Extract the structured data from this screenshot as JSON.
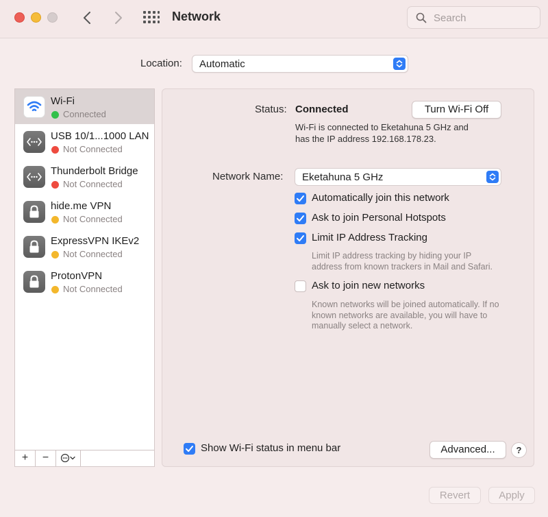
{
  "window": {
    "title": "Network",
    "search_placeholder": "Search"
  },
  "location": {
    "label": "Location:",
    "value": "Automatic"
  },
  "services": [
    {
      "name": "Wi-Fi",
      "status": "Connected",
      "status_color": "#32c04a",
      "icon": "wifi-icon",
      "selected": true
    },
    {
      "name": "USB 10/1...1000 LAN",
      "status": "Not Connected",
      "status_color": "#ee4b3f",
      "icon": "ethernet-icon",
      "selected": false
    },
    {
      "name": "Thunderbolt Bridge",
      "status": "Not Connected",
      "status_color": "#ee4b3f",
      "icon": "ethernet-icon",
      "selected": false
    },
    {
      "name": "hide.me VPN",
      "status": "Not Connected",
      "status_color": "#f3b72c",
      "icon": "lock-icon",
      "selected": false
    },
    {
      "name": "ExpressVPN IKEv2",
      "status": "Not Connected",
      "status_color": "#f3b72c",
      "icon": "lock-icon",
      "selected": false
    },
    {
      "name": "ProtonVPN",
      "status": "Not Connected",
      "status_color": "#f3b72c",
      "icon": "lock-icon",
      "selected": false
    }
  ],
  "sidebar_toolbar": {
    "add": "+",
    "remove": "−"
  },
  "detail": {
    "status_label": "Status:",
    "status_value": "Connected",
    "toggle_button": "Turn Wi-Fi Off",
    "status_line1": "Wi-Fi is connected to Eketahuna 5 GHz and",
    "status_line2": "has the IP address 192.168.178.23.",
    "network_name_label": "Network Name:",
    "network_name_value": "Eketahuna 5 GHz",
    "options": [
      {
        "label": "Automatically join this network",
        "checked": true
      },
      {
        "label": "Ask to join Personal Hotspots",
        "checked": true
      },
      {
        "label": "Limit IP Address Tracking",
        "checked": true
      },
      {
        "label": "Ask to join new networks",
        "checked": false
      }
    ],
    "limit_help_line1": "Limit IP address tracking by hiding your IP",
    "limit_help_line2": "address from known trackers in Mail and Safari.",
    "new_help_line1": "Known networks will be joined automatically. If no",
    "new_help_line2": "known networks are available, you will have to",
    "new_help_line3": "manually select a network.",
    "menubar_label": "Show Wi-Fi status in menu bar",
    "menubar_checked": true,
    "advanced_button": "Advanced...",
    "help_button": "?"
  },
  "footer": {
    "revert": "Revert",
    "apply": "Apply"
  },
  "colors": {
    "accent": "#2f7cf6",
    "window_bg": "#f6ecec"
  }
}
